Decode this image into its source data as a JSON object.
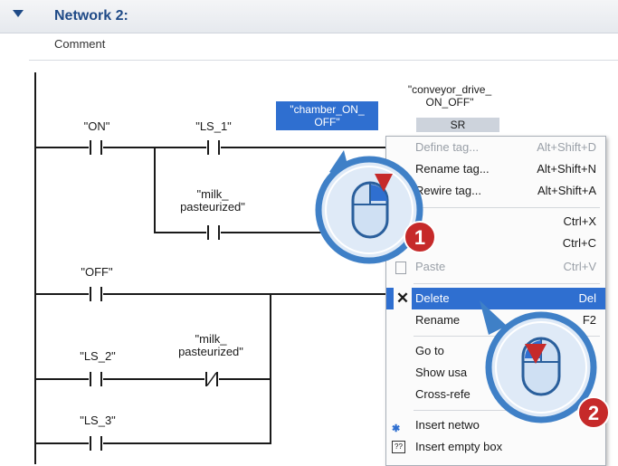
{
  "network": {
    "title": "Network 2:",
    "comment": "Comment"
  },
  "ladder": {
    "on": "\"ON\"",
    "ls1": "\"LS_1\"",
    "milk_pasteurized_a": "\"milk_\npasteurized\"",
    "off": "\"OFF\"",
    "ls2": "\"LS_2\"",
    "milk_pasteurized_b": "\"milk_\npasteurized\"",
    "ls3": "\"LS_3\"",
    "chamber": "\"chamber_ON_\nOFF\"",
    "conveyor": "\"conveyor_drive_\nON_OFF\"",
    "sr": "SR"
  },
  "menu": {
    "items": [
      {
        "label": "Define tag...",
        "shortcut": "Alt+Shift+D"
      },
      {
        "label": "Rename tag...",
        "shortcut": "Alt+Shift+N"
      },
      {
        "label": "Rewire tag...",
        "shortcut": "Alt+Shift+A"
      },
      {
        "label": "",
        "shortcut": "Ctrl+X"
      },
      {
        "label": "",
        "shortcut": "Ctrl+C"
      },
      {
        "label": "Paste",
        "shortcut": "Ctrl+V"
      },
      {
        "label": "Delete",
        "shortcut": "Del"
      },
      {
        "label": "Rename",
        "shortcut": "F2"
      },
      {
        "label": "Go to",
        "shortcut": ""
      },
      {
        "label": "Show usa",
        "shortcut": ""
      },
      {
        "label": "Cross-refe",
        "shortcut": ""
      },
      {
        "label": "Insert netwo",
        "shortcut": ""
      },
      {
        "label": "Insert empty box",
        "shortcut": ""
      }
    ]
  },
  "callouts": {
    "one": "1",
    "two": "2"
  },
  "colors": {
    "accent": "#2f6fd0",
    "badge": "#c62a2a",
    "callout_ring": "#3f80c7"
  }
}
